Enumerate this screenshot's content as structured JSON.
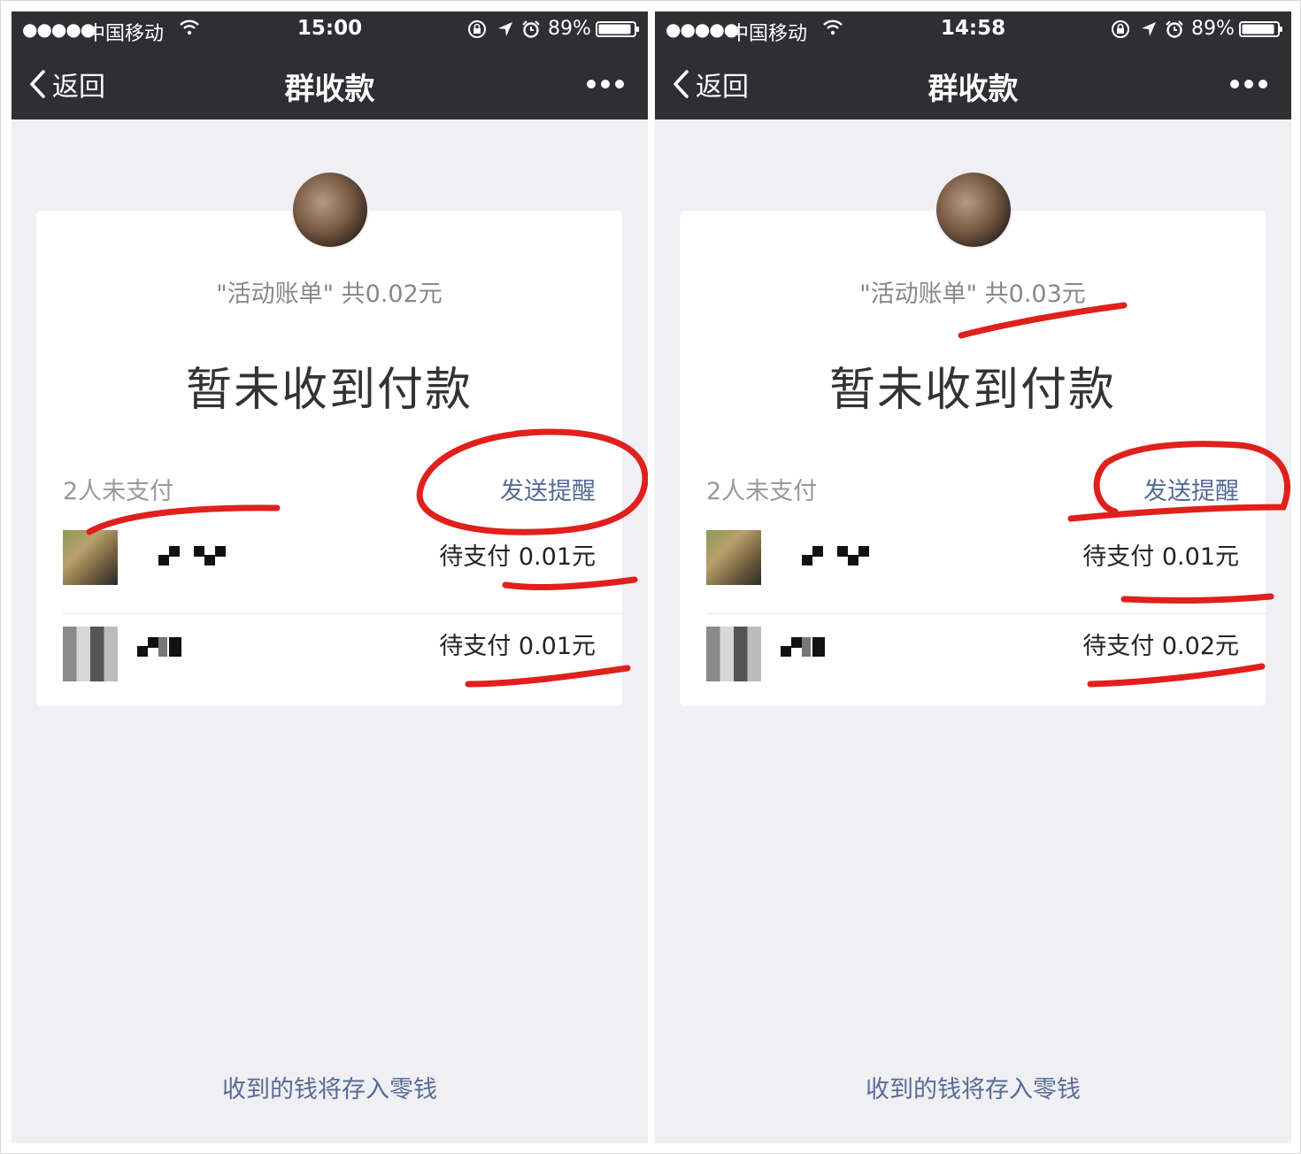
{
  "screens": [
    {
      "status_bar": {
        "signal": "●●●●●",
        "carrier": "中国移动",
        "time": "15:00",
        "battery": "89%"
      },
      "nav": {
        "back_label": "返回",
        "title": "群收款"
      },
      "bill_title": "\"活动账单\" 共0.02元",
      "headline": "暂未收到付款",
      "unpaid_label": "2人未支付",
      "remind_label": "发送提醒",
      "members": [
        {
          "amount": "待支付 0.01元"
        },
        {
          "amount": "待支付 0.01元"
        }
      ],
      "footer_link": "收到的钱将存入零钱"
    },
    {
      "status_bar": {
        "signal": "●●●●●",
        "carrier": "中国移动",
        "time": "14:58",
        "battery": "89%"
      },
      "nav": {
        "back_label": "返回",
        "title": "群收款"
      },
      "bill_title": "\"活动账单\" 共0.03元",
      "headline": "暂未收到付款",
      "unpaid_label": "2人未支付",
      "remind_label": "发送提醒",
      "members": [
        {
          "amount": "待支付 0.01元"
        },
        {
          "amount": "待支付 0.02元"
        }
      ],
      "footer_link": "收到的钱将存入零钱"
    }
  ],
  "colors": {
    "nav_bg": "#2e2e33",
    "page_bg": "#efeff4",
    "link": "#576b95",
    "annotation_red": "#e0201c"
  }
}
